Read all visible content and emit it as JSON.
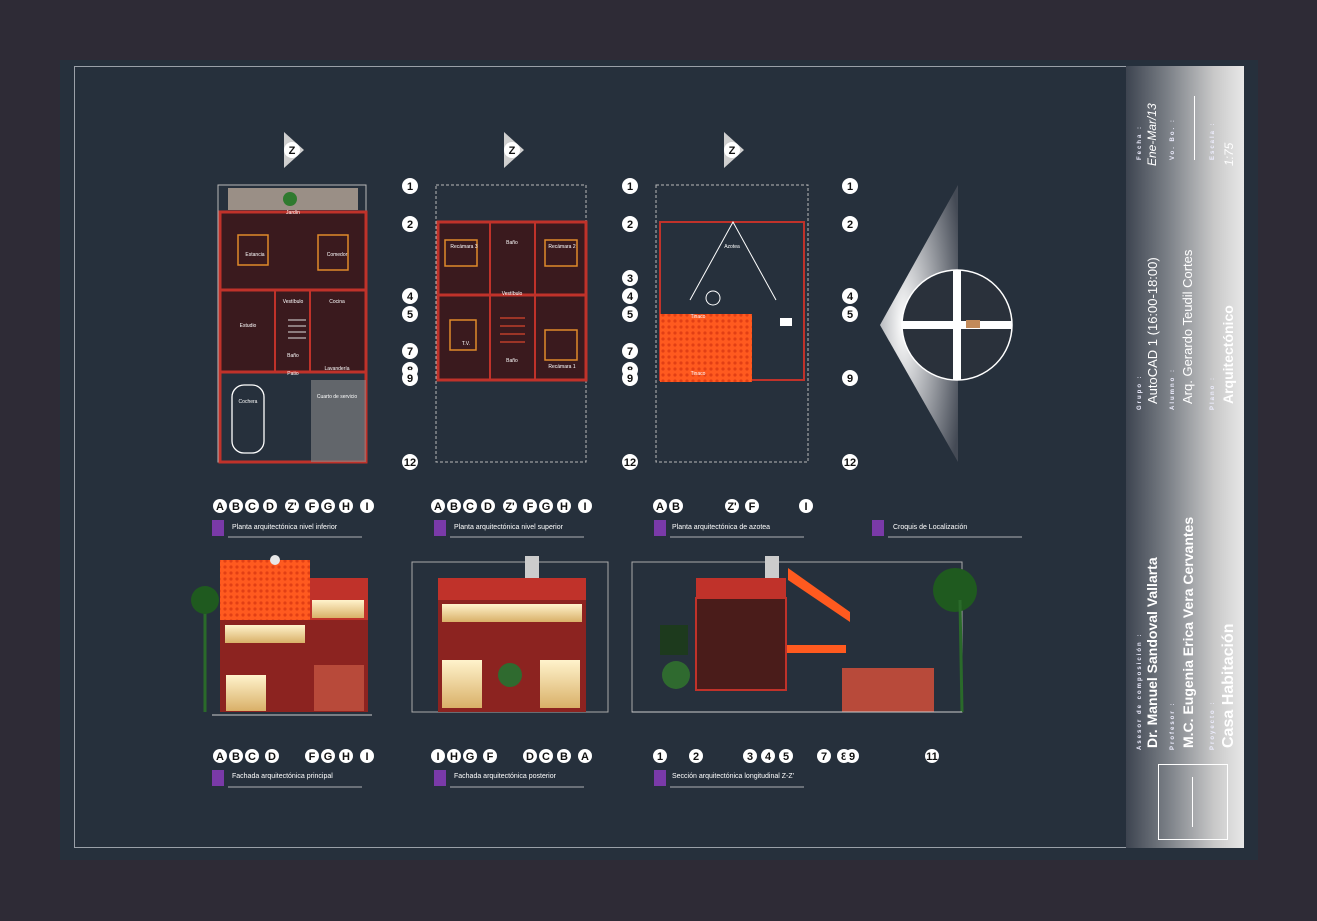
{
  "north_label": "Z",
  "axes": {
    "plan_rows": [
      "1",
      "2",
      "3",
      "4",
      "5",
      "7",
      "8",
      "9",
      "10",
      "12"
    ],
    "plan_cols_lower": [
      "A",
      "B",
      "C",
      "D",
      "Z'",
      "F",
      "G",
      "H",
      "I"
    ],
    "plan_cols_upper": [
      "A",
      "B",
      "C",
      "D",
      "Z'",
      "F",
      "G",
      "H",
      "I"
    ],
    "plan_cols_roof": [
      "A",
      "B",
      "Z'",
      "F",
      "I"
    ],
    "facade_main_cols": [
      "A",
      "B",
      "C",
      "D",
      "F",
      "G",
      "H",
      "I"
    ],
    "facade_rear_cols": [
      "I",
      "H",
      "G",
      "F",
      "D",
      "C",
      "B",
      "A"
    ],
    "section_cols": [
      "1",
      "2",
      "3",
      "4",
      "5",
      "7",
      "8",
      "9",
      "11"
    ]
  },
  "captions": {
    "plan_lower": "Planta arquitectónica nivel inferior",
    "plan_upper": "Planta arquitectónica nivel superior",
    "plan_roof": "Planta arquitectónica de azotea",
    "location": "Croquis de Localización",
    "facade_main": "Fachada arquitectónica principal",
    "facade_rear": "Fachada arquitectónica posterior",
    "section": "Sección arquitectónica longitudinal Z-Z'"
  },
  "room_labels": {
    "lower": [
      "Jardín",
      "Estancia",
      "Comedor",
      "Vestíbulo",
      "Cocina",
      "Estudio",
      "Baño",
      "Lavandería",
      "Cochera",
      "Patio",
      "Cuarto de servicio"
    ],
    "upper": [
      "Recámara 3",
      "Baño",
      "Recámara 2",
      "Vestíbulo",
      "T.V.",
      "Baño",
      "Recámara 1"
    ],
    "roof": [
      "Azotea",
      "Tinaco",
      "Tinaco"
    ]
  },
  "title_block": {
    "asesor_caption": "Asesor de composición :",
    "asesor": "Dr. Manuel Sandoval Vallarta",
    "profesor_caption": "Profesor :",
    "profesor": "M.C. Eugenia Erica Vera Cervantes",
    "proyecto_caption": "Proyecto :",
    "proyecto": "Casa Habitación",
    "grupo_caption": "Grupo :",
    "grupo": "AutoCAD 1 (16:00-18:00)",
    "alumno_caption": "Alumno :",
    "alumno": "Arq. Gerardo Teudil Cortes",
    "plano_caption": "Plano :",
    "plano": "Arquitectónico",
    "fecha_caption": "Fecha :",
    "fecha": "Ene-Mar/13",
    "vobo_caption": "Vo. Bo. :",
    "escala_caption": "Escala :",
    "escala": "1:75"
  },
  "colors": {
    "sheet": "#26303c",
    "wall": "#c0322a",
    "roof_tile": "#ff5a1f",
    "axis_bubble": "#ffffff",
    "lines": "#c8c8c8"
  }
}
